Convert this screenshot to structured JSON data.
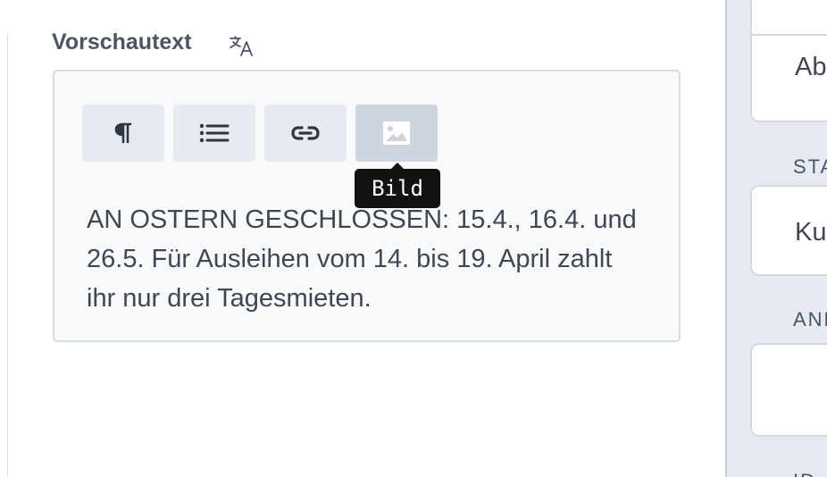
{
  "main": {
    "field_label": "Vorschautext",
    "translate_icon": "translate-icon",
    "editor": {
      "toolbar": {
        "buttons": [
          {
            "name": "paragraph",
            "icon": "pilcrow-icon"
          },
          {
            "name": "list",
            "icon": "list-icon"
          },
          {
            "name": "link",
            "icon": "link-icon"
          },
          {
            "name": "image",
            "icon": "image-icon",
            "active": true
          }
        ]
      },
      "tooltip": "Bild",
      "content": "AN OSTERN GESCHLOSSEN: 15.4., 16.4. und 26.5. Für Ausleihen vom 14. bis 19. April zahlt ihr nur drei Tagesmieten."
    }
  },
  "right_panel": {
    "top_card_value": "Abl",
    "status_label": "STA",
    "status_value": "Kul",
    "notes_label": "ANN",
    "bottom_label": "ID"
  },
  "colors": {
    "label": "#4c5563",
    "text": "#3f4754",
    "editor_bg": "#f8f9fb",
    "editor_border": "#d7dbe5",
    "button_bg": "#e7eaf0",
    "button_active_bg": "#cfd5df",
    "tooltip_bg": "#111111",
    "panel_bg": "#e5eaf3"
  }
}
